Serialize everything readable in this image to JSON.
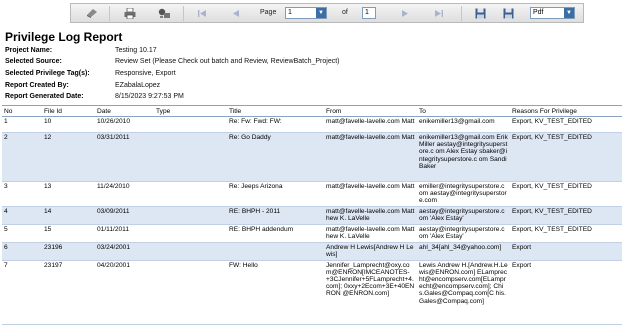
{
  "toolbar": {
    "page_label": "Page",
    "page_value": "1",
    "of_label": "of",
    "total_pages": "1",
    "export_format": "Pdf"
  },
  "report": {
    "title": "Privilege Log Report",
    "meta": [
      {
        "key": "Project Name:",
        "value": "Testing 10.17"
      },
      {
        "key": "Selected Source:",
        "value": "Review Set (Please Check out batch and Review, ReviewBatch_Project)"
      },
      {
        "key": "Selected Privilege Tag(s):",
        "value": "Responsive, Export"
      },
      {
        "key": "Report Created By:",
        "value": "EZabalaLopez"
      },
      {
        "key": "Report Generated Date:",
        "value": "8/15/2023 9:27:53 PM"
      }
    ]
  },
  "table": {
    "columns": [
      "No",
      "File Id",
      "Date",
      "Type",
      "Title",
      "From",
      "To",
      "Reasons For Privilege"
    ],
    "rows": [
      {
        "no": "1",
        "file_id": "10",
        "date": "10/26/2010",
        "type": "",
        "title": "Re: Fw: Fwd: FW:",
        "from": "matt@favelle-lavelle.com Matt",
        "to": "enikemiller13@gmail.com",
        "reason": "Export, KV_TEST_EDITED"
      },
      {
        "no": "2",
        "file_id": "12",
        "date": "03/31/2011",
        "type": "",
        "title": "Re: Go Daddy",
        "from": "matt@favelle-lavelle.com Matt",
        "to": "enikemiller13@gmail.com Erik Miller aestay@integritysuperstore.c om Alex Estay sbaker@integritysuperstore.c om Sandi Baker",
        "reason": "Export, KV_TEST_EDITED"
      },
      {
        "no": "3",
        "file_id": "13",
        "date": "11/24/2010",
        "type": "",
        "title": "Re: Jeeps Arizona",
        "from": "matt@favelle-lavelle.com Matt",
        "to": "emiller@integritysuperstore.com aestay@integritysuperstore.com",
        "reason": "Export, KV_TEST_EDITED"
      },
      {
        "no": "4",
        "file_id": "14",
        "date": "03/09/2011",
        "type": "",
        "title": "RE: BHPH - 2011",
        "from": "matt@favelle-lavelle.com Matthew K. LaVelle",
        "to": "aestay@integritysuperstore.c om 'Alex Estay'",
        "reason": "Export, KV_TEST_EDITED"
      },
      {
        "no": "5",
        "file_id": "15",
        "date": "01/11/2011",
        "type": "",
        "title": "RE: BHPH addendum",
        "from": "matt@favelle-lavelle.com Matthew K. LaVelle",
        "to": "aestay@integritysuperstore.c om 'Alex Estay'",
        "reason": "Export, KV_TEST_EDITED"
      },
      {
        "no": "6",
        "file_id": "23196",
        "date": "03/24/2001",
        "type": "",
        "title": "",
        "from": "Andrew H Lewis[Andrew H Lewis]",
        "to": "ahl_34[ahl_34@yahoo.com]",
        "reason": "Export"
      },
      {
        "no": "7",
        "file_id": "23197",
        "date": "04/20/2001",
        "type": "",
        "title": "FW: Hello",
        "from": "Jennifer_Lamprecht@oxy.co m@ENRON[IMCEANOTES- +3CJennifer+5FLamprecht+4.com]; 0xxy+2Ecom+3E+40ENRON @ENRON.com]",
        "to": "Lewis Andrew H.[Andrew.H.Lewis@ENRON.com] ELamprecht@encompserv.com[ELamprecht@encompserv.com]; Chis.Gales@Compaq.com[C his.Gales@Compaq.com]",
        "reason": "Export"
      }
    ]
  }
}
